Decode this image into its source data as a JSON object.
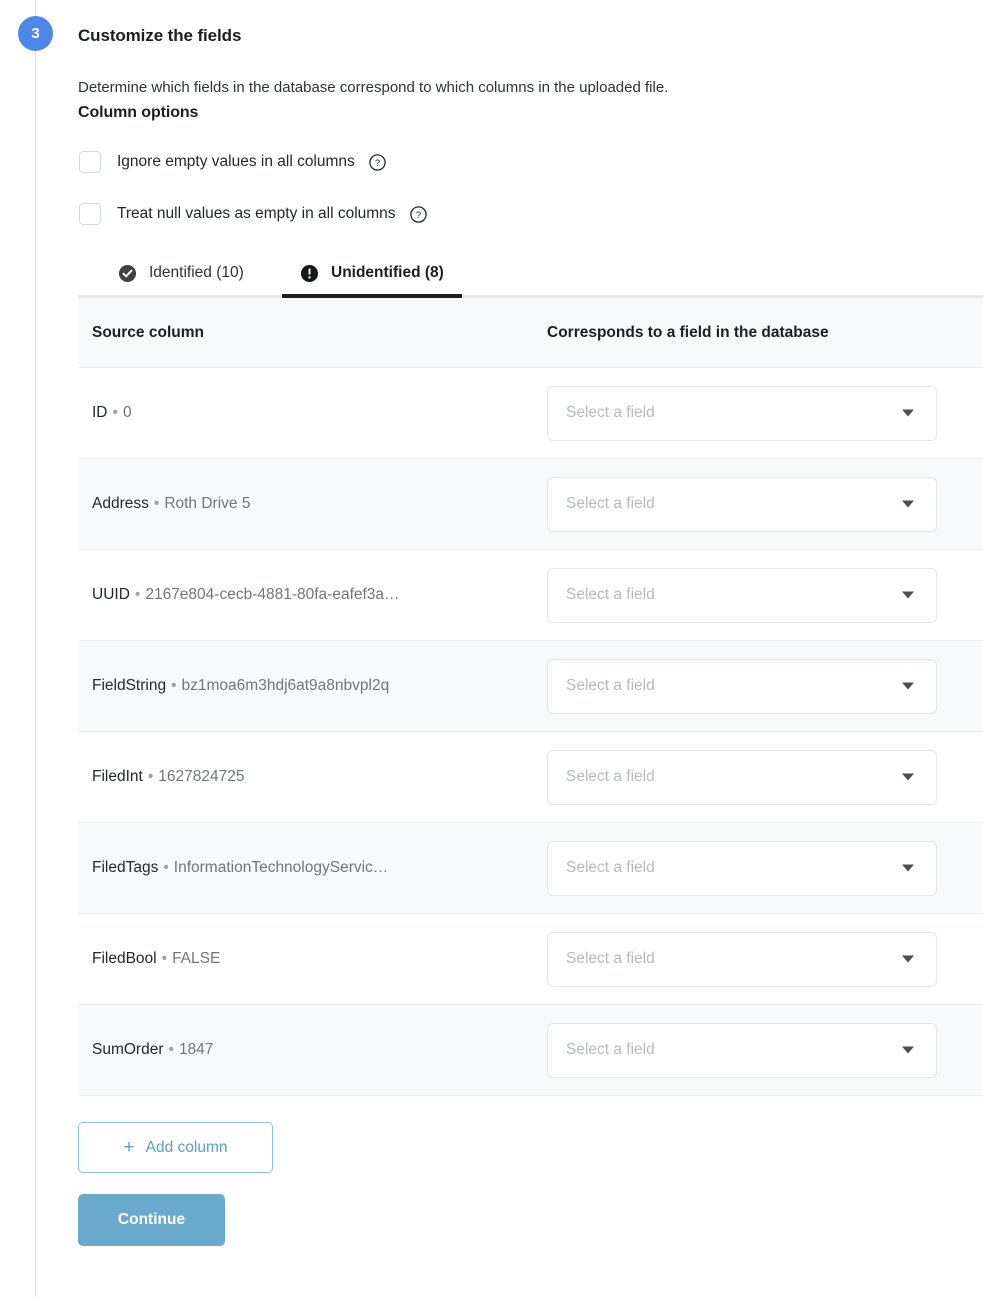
{
  "step": {
    "number": "3",
    "title": "Customize the fields"
  },
  "description": "Determine which fields in the database correspond to which columns in the uploaded file.",
  "subtitle": "Column options",
  "options": [
    {
      "label": "Ignore empty values in all columns",
      "help_icon": "help-circle-icon",
      "checked": false
    },
    {
      "label": "Treat null values as empty in all columns",
      "help_icon": "help-circle-icon",
      "checked": false
    }
  ],
  "tabs": [
    {
      "label": "Identified (10)",
      "icon": "check-circle-icon",
      "active": false
    },
    {
      "label": "Unidentified (8)",
      "icon": "exclamation-circle-icon",
      "active": true
    }
  ],
  "table": {
    "headers": {
      "source": "Source column",
      "field": "Corresponds to a field in the database"
    },
    "select_placeholder": "Select a field",
    "separator": "•",
    "rows": [
      {
        "name": "ID",
        "value": "0"
      },
      {
        "name": "Address",
        "value": "Roth Drive 5"
      },
      {
        "name": "UUID",
        "value": "2167e804-cecb-4881-80fa-eafef3a…"
      },
      {
        "name": "FieldString",
        "value": "bz1moa6m3hdj6at9a8nbvpl2q"
      },
      {
        "name": "FiledInt",
        "value": "1627824725"
      },
      {
        "name": "FiledTags",
        "value": "InformationTechnologyServic…"
      },
      {
        "name": "FiledBool",
        "value": "FALSE"
      },
      {
        "name": "SumOrder",
        "value": "1847"
      }
    ]
  },
  "buttons": {
    "add_column": "Add column",
    "add_column_icon": "plus-icon",
    "continue": "Continue"
  },
  "colors": {
    "step_badge": "#4d87e8",
    "accent_blue": "#6aabcd",
    "link_blue": "#5b9fc9",
    "active_tab_underline": "#1b1f23",
    "row_alt": "#f6fafb"
  }
}
